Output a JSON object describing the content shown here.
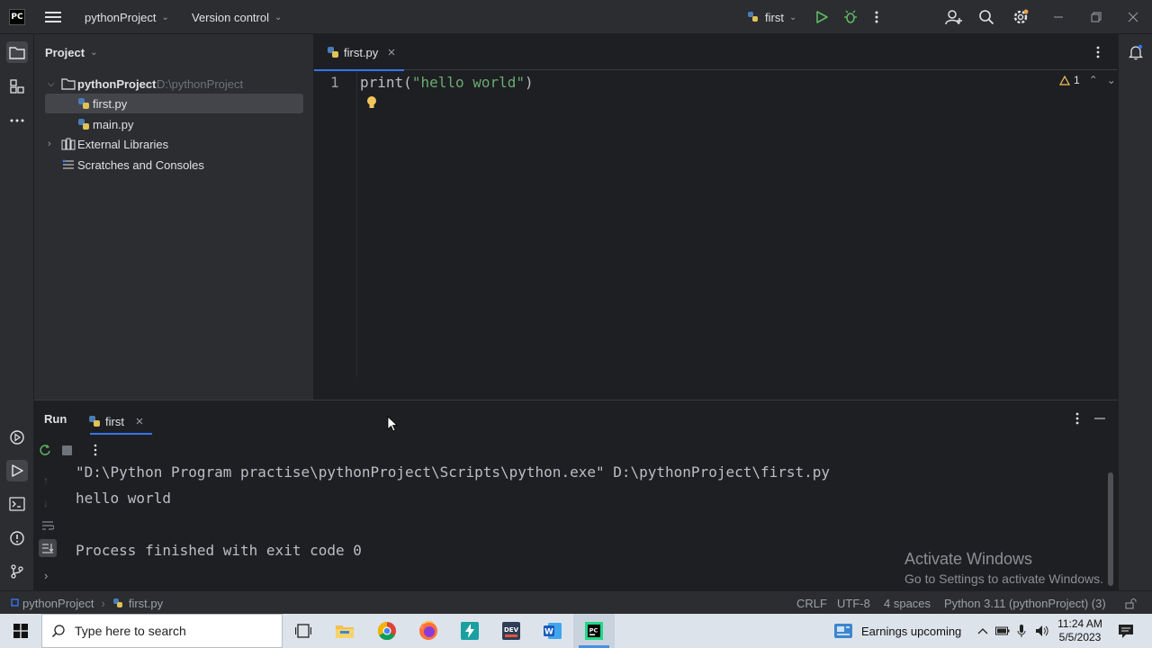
{
  "titlebar": {
    "app_logo": "PC",
    "project_name": "pythonProject",
    "vcs_label": "Version control",
    "run_config": "first"
  },
  "project_panel": {
    "title": "Project",
    "root_name": "pythonProject",
    "root_path": "D:\\pythonProject",
    "files": [
      "first.py",
      "main.py"
    ],
    "external_libraries": "External Libraries",
    "scratches": "Scratches and Consoles"
  },
  "editor": {
    "tab_label": "first.py",
    "line_number": "1",
    "code_func": "print",
    "code_open": "(",
    "code_string": "\"hello world\"",
    "code_close": ")",
    "warnings_count": "1"
  },
  "run_panel": {
    "title": "Run",
    "tab_label": "first",
    "lines": [
      "\"D:\\Python Program practise\\pythonProject\\Scripts\\python.exe\" D:\\pythonProject\\first.py",
      "hello world",
      "",
      "Process finished with exit code 0"
    ],
    "watermark_title": "Activate Windows",
    "watermark_sub": "Go to Settings to activate Windows."
  },
  "statusbar": {
    "crumb_project": "pythonProject",
    "crumb_file": "first.py",
    "line_sep": "CRLF",
    "encoding": "UTF-8",
    "indent": "4 spaces",
    "interpreter": "Python 3.11 (pythonProject) (3)"
  },
  "taskbar": {
    "search_placeholder": "Type here to search",
    "news": "Earnings upcoming",
    "time": "11:24 AM",
    "date": "5/5/2023"
  },
  "colors": {
    "accent": "#3574f0",
    "string": "#6aab73",
    "run_green": "#5fb865"
  }
}
